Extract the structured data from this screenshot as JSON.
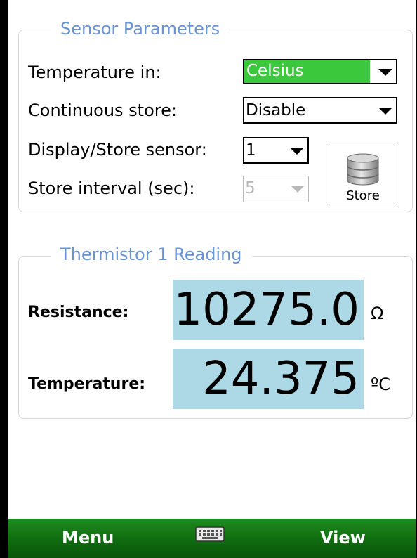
{
  "sensor_params": {
    "title": "Sensor Parameters",
    "temperature_in": {
      "label": "Temperature in:",
      "value": "Celsius",
      "highlight": "#3cc83c"
    },
    "continuous_store": {
      "label": "Continuous store:",
      "value": "Disable"
    },
    "display_store_sensor": {
      "label": "Display/Store sensor:",
      "value": "1"
    },
    "store_interval": {
      "label": "Store interval (sec):",
      "value": "5",
      "enabled": false
    },
    "store_button": {
      "label": "Store",
      "icon": "database-icon"
    }
  },
  "reading": {
    "title": "Thermistor 1 Reading",
    "resistance": {
      "label": "Resistance:",
      "value": "10275.0",
      "unit": "Ω"
    },
    "temperature": {
      "label": "Temperature:",
      "value": "24.375",
      "unit": "ºC"
    },
    "value_background": "#add8e6"
  },
  "menubar": {
    "left": "Menu",
    "right": "View",
    "center_icon": "keyboard-icon"
  }
}
